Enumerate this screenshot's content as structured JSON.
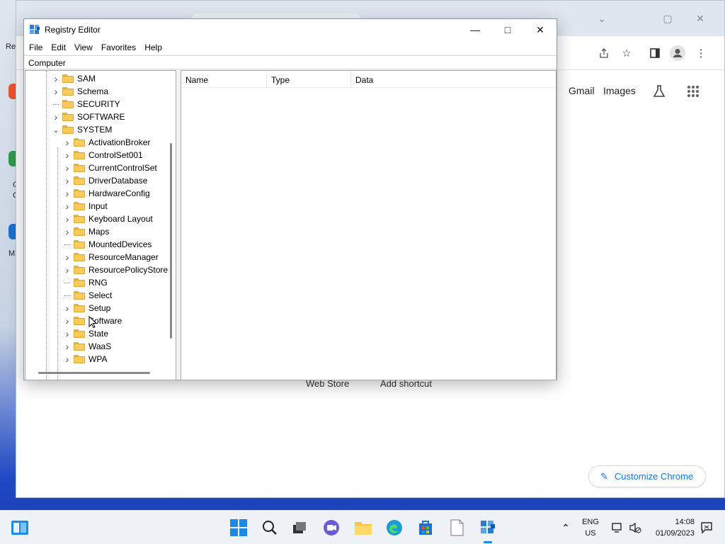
{
  "desktop": {
    "labels": [
      "Re",
      "C",
      "C",
      "M"
    ]
  },
  "chrome": {
    "toolbar_icons": [
      "share-icon",
      "star-icon",
      "sidepanel-icon",
      "profile-icon",
      "menu-icon"
    ],
    "window_controls": [
      "minimize-icon",
      "maximize-icon",
      "close-icon"
    ],
    "links": {
      "gmail": "Gmail",
      "images": "Images"
    },
    "shortcuts": {
      "web_store": "Web Store",
      "add_shortcut": "Add shortcut"
    },
    "customize_label": "Customize Chrome"
  },
  "regedit": {
    "title": "Registry Editor",
    "menu": [
      "File",
      "Edit",
      "View",
      "Favorites",
      "Help"
    ],
    "address": "Computer",
    "tree": {
      "top_level": [
        {
          "label": "SAM",
          "expandable": true
        },
        {
          "label": "Schema",
          "expandable": true
        },
        {
          "label": "SECURITY",
          "expandable": false
        },
        {
          "label": "SOFTWARE",
          "expandable": true
        },
        {
          "label": "SYSTEM",
          "expandable": true,
          "expanded": true
        }
      ],
      "system_children": [
        {
          "label": "ActivationBroker",
          "expandable": true
        },
        {
          "label": "ControlSet001",
          "expandable": true
        },
        {
          "label": "CurrentControlSet",
          "expandable": true
        },
        {
          "label": "DriverDatabase",
          "expandable": true
        },
        {
          "label": "HardwareConfig",
          "expandable": true
        },
        {
          "label": "Input",
          "expandable": true
        },
        {
          "label": "Keyboard Layout",
          "expandable": true
        },
        {
          "label": "Maps",
          "expandable": true
        },
        {
          "label": "MountedDevices",
          "expandable": false
        },
        {
          "label": "ResourceManager",
          "expandable": true
        },
        {
          "label": "ResourcePolicyStore",
          "expandable": true
        },
        {
          "label": "RNG",
          "expandable": false
        },
        {
          "label": "Select",
          "expandable": false
        },
        {
          "label": "Setup",
          "expandable": true
        },
        {
          "label": "Software",
          "expandable": true
        },
        {
          "label": "State",
          "expandable": true
        },
        {
          "label": "WaaS",
          "expandable": true
        },
        {
          "label": "WPA",
          "expandable": true
        }
      ]
    },
    "columns": [
      "Name",
      "Type",
      "Data"
    ]
  },
  "taskbar": {
    "apps": [
      "start-icon",
      "search-icon",
      "task-view-icon",
      "chat-icon",
      "file-explorer-icon",
      "edge-icon",
      "store-icon",
      "notepad-icon",
      "regedit-icon"
    ],
    "language": "ENG",
    "region": "US",
    "time": "14:08",
    "date": "01/09/2023"
  }
}
